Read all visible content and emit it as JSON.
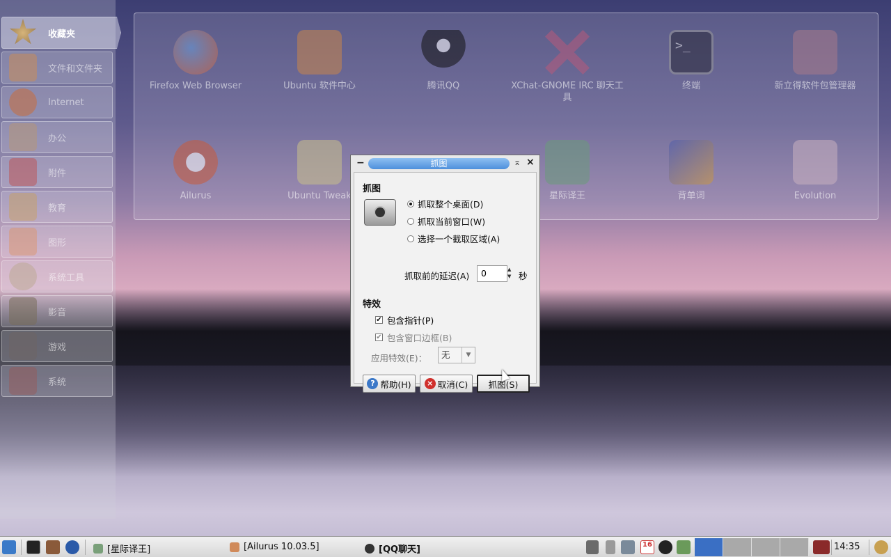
{
  "sidebar": {
    "categories": [
      {
        "label": "收藏夹",
        "icon": "star-icon",
        "active": true
      },
      {
        "label": "文件和文件夹",
        "icon": "folder-icon"
      },
      {
        "label": "Internet",
        "icon": "globe-icon"
      },
      {
        "label": "办公",
        "icon": "office-icon"
      },
      {
        "label": "附件",
        "icon": "accessories-icon"
      },
      {
        "label": "教育",
        "icon": "education-icon"
      },
      {
        "label": "图形",
        "icon": "graphics-icon"
      },
      {
        "label": "系统工具",
        "icon": "gear-icon"
      },
      {
        "label": "影音",
        "icon": "media-icon"
      },
      {
        "label": "游戏",
        "icon": "games-icon"
      },
      {
        "label": "系统",
        "icon": "system-icon"
      }
    ]
  },
  "apps": [
    {
      "label": "Firefox Web Browser",
      "icon": "firefox-icon"
    },
    {
      "label": "Ubuntu 软件中心",
      "icon": "software-center-icon"
    },
    {
      "label": "腾讯QQ",
      "icon": "qq-penguin-icon"
    },
    {
      "label": "XChat-GNOME IRC 聊天工具",
      "icon": "xchat-icon"
    },
    {
      "label": "终端",
      "icon": "terminal-icon"
    },
    {
      "label": "新立得软件包管理器",
      "icon": "synaptic-icon"
    },
    {
      "label": "Ailurus",
      "icon": "red-panda-icon"
    },
    {
      "label": "Ubuntu Tweak",
      "icon": "ubuntu-tweak-icon"
    },
    {
      "label": "星际译王",
      "icon": "stardict-icon"
    },
    {
      "label": "背单词",
      "icon": "word-learning-icon"
    },
    {
      "label": "Evolution",
      "icon": "evolution-icon"
    }
  ],
  "dialog": {
    "title": "抓图",
    "section_capture": "抓图",
    "radio_desktop": "抓取整个桌面(D)",
    "radio_window": "抓取当前窗口(W)",
    "radio_area": "选择一个截取区域(A)",
    "delay_label": "抓取前的延迟(A)",
    "delay_value": "0",
    "delay_unit": "秒",
    "section_effects": "特效",
    "check_pointer": "包含指针(P)",
    "check_border": "包含窗口边框(B)",
    "effect_label": "应用特效(E)：",
    "effect_value": "无",
    "help_button": "帮助(H)",
    "cancel_button": "取消(C)",
    "capture_button": "抓图(S)"
  },
  "taskbar": {
    "tasks": [
      "[星际译王]",
      "[Ailurus 10.03.5]",
      "[QQ聊天]"
    ],
    "calendar_day": "16",
    "clock": "14:35"
  },
  "colors": {
    "title_accent": "#4d8fdc",
    "pager_active": "#3a6fc4"
  }
}
